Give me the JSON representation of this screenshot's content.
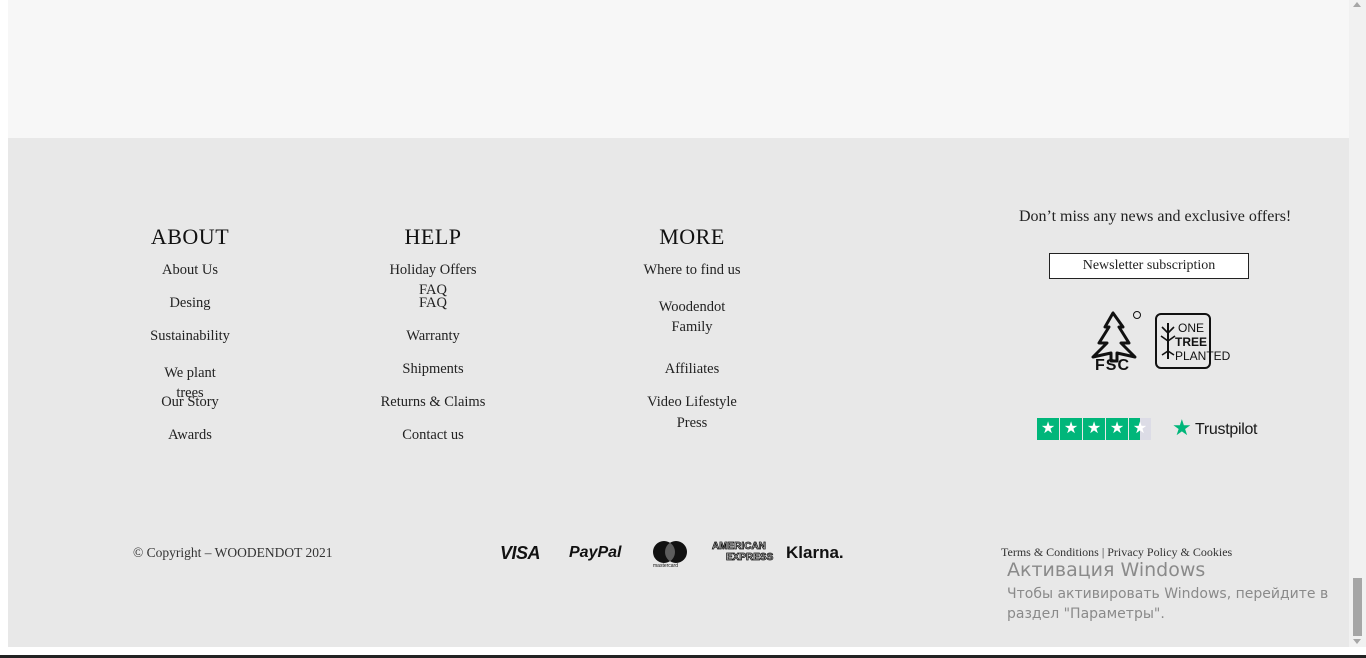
{
  "columns": [
    {
      "title": "ABOUT",
      "links": [
        "About Us",
        "Desing",
        "Sustainability",
        "We plant trees",
        "Our Story",
        "Awards"
      ]
    },
    {
      "title": "HELP",
      "links": [
        "Holiday Offers",
        "FAQ",
        "FAQ",
        "Warranty",
        "Shipments",
        "Returns & Claims",
        "Contact us"
      ]
    },
    {
      "title": "MORE",
      "links": [
        "Where to find us",
        "Woodendot Family",
        "Press",
        "Affiliates",
        "Video Lifestyle"
      ]
    }
  ],
  "newsletter": {
    "text": "Don’t miss any news and exclusive offers!",
    "button": "Newsletter subscription"
  },
  "badges": {
    "fsc": "FSC",
    "fsc_mark": "©",
    "one_tree": [
      "ONE",
      "TREE",
      "PLANTED"
    ],
    "trustpilot": "Trustpilot",
    "trustpilot_rating": 4.5,
    "trustpilot_color": "#00b67a"
  },
  "footer_bottom": {
    "copyright": "© Copyright – WOODENDOT 2021",
    "payments": {
      "visa": "VISA",
      "paypal": "PayPal",
      "mastercard": "mastercard",
      "amex_1": "AMERICAN",
      "amex_2": "EXPRESS",
      "klarna": "Klarna."
    },
    "terms": "Terms & Conditions",
    "separator": "|",
    "privacy": "Privacy Policy & Cookies"
  },
  "windows_watermark": {
    "title": "Активация Windows",
    "line1": "Чтобы активировать Windows, перейдите в",
    "line2": "раздел \"Параметры\"."
  }
}
